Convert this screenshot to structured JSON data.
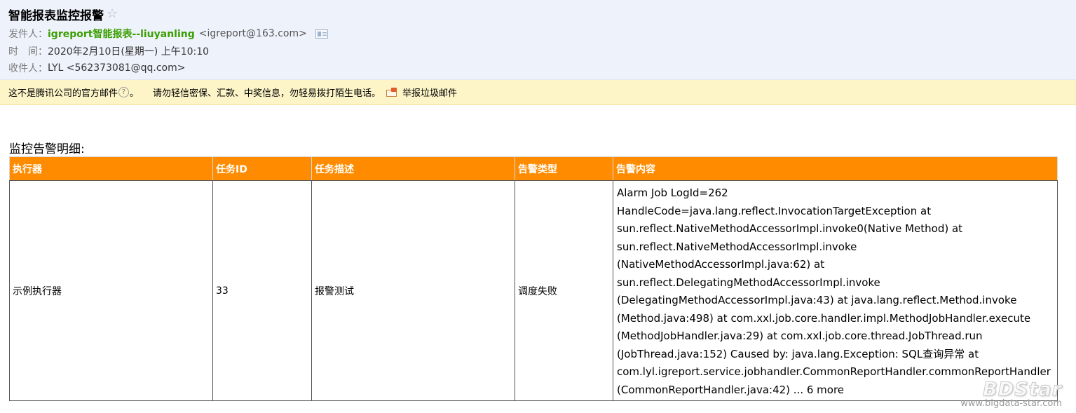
{
  "mail": {
    "subject": "智能报表监控报警",
    "star_glyph": "☆",
    "from_label": "发件人：",
    "from_name": "igreport智能报表--liuyanling",
    "from_addr": "<igreport@163.com>",
    "time_label": "时　间：",
    "time_value": "2020年2月10日(星期一) 上午10:10",
    "to_label": "收件人：",
    "to_value": "LYL <562373081@qq.com>"
  },
  "warning": {
    "text_part1": "这不是腾讯公司的官方邮件",
    "help_glyph": "?",
    "text_part2": "。",
    "text_part3": "请勿轻信密保、汇款、中奖信息，勿轻易拨打陌生电话。",
    "report_label": "举报垃圾邮件"
  },
  "body": {
    "section_title": "监控告警明细:",
    "table": {
      "headers": [
        "执行器",
        "任务ID",
        "任务描述",
        "告警类型",
        "告警内容"
      ],
      "rows": [
        {
          "executor": "示例执行器",
          "task_id": "33",
          "task_desc": "报警测试",
          "alarm_type": "调度失败",
          "alarm_content": "Alarm Job LogId=262\nHandleCode=java.lang.reflect.InvocationTargetException at\nsun.reflect.NativeMethodAccessorImpl.invoke0(Native Method) at\nsun.reflect.NativeMethodAccessorImpl.invoke\n(NativeMethodAccessorImpl.java:62) at\nsun.reflect.DelegatingMethodAccessorImpl.invoke\n(DelegatingMethodAccessorImpl.java:43) at java.lang.reflect.Method.invoke\n(Method.java:498) at com.xxl.job.core.handler.impl.MethodJobHandler.execute\n(MethodJobHandler.java:29) at com.xxl.job.core.thread.JobThread.run\n(JobThread.java:152) Caused by: java.lang.Exception: SQL查询异常 at\ncom.lyl.igreport.service.jobhandler.CommonReportHandler.commonReportHandler\n(CommonReportHandler.java:42) ... 6 more"
        }
      ]
    }
  },
  "watermark": {
    "logo": "BDStar",
    "url": "www.bigdata-star.com"
  },
  "colors": {
    "header_bg": "#eef2fb",
    "sender_green": "#3a9f00",
    "warning_bg": "#fdf5c8",
    "table_header_orange": "#ff8c00"
  },
  "icons": [
    "star-icon",
    "contact-card-icon",
    "help-icon",
    "report-spam-icon"
  ]
}
